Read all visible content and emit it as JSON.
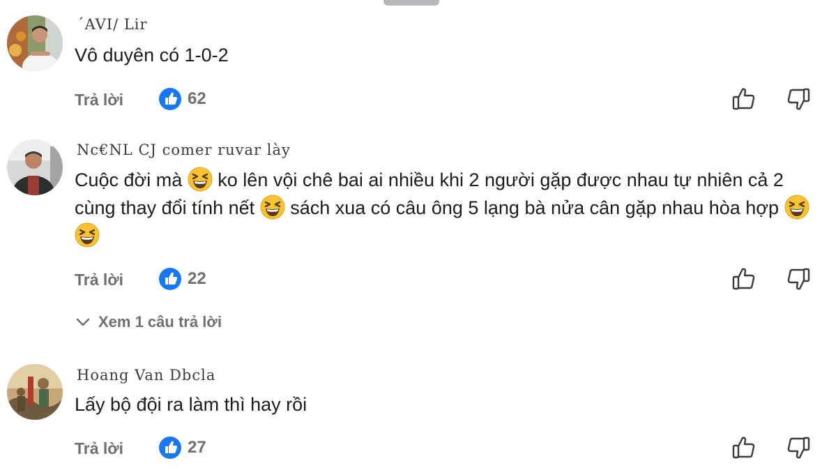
{
  "comments": [
    {
      "author": "ˊAVI/ Lir",
      "text": "Vô duyên có 1-0-2",
      "reply_label": "Trả lời",
      "like_count": "62"
    },
    {
      "author": "Nc€NL CJ comer ruvar lày",
      "text_parts": [
        "Cuộc đời mà",
        " ko lên vội chê bai ai nhiều khi 2 người gặp được nhau tự nhiên cả 2 cùng thay đổi tính nết",
        " sách xua có câu ông 5 lạng bà nửa cân gặp nhau hòa hợp"
      ],
      "reply_label": "Trả lời",
      "like_count": "22",
      "view_replies_label": "Xem 1 câu trả lời"
    },
    {
      "author": "Hoang Van Dbcla",
      "text": "Lấy bộ đội ra làm thì hay rồi",
      "reply_label": "Trả lời",
      "like_count": "27"
    }
  ],
  "icons": {
    "reaction": "like-reaction-icon",
    "like": "thumbs-up-outline-icon",
    "dislike": "thumbs-down-outline-icon",
    "expand": "chevron-down-icon",
    "emoji": "grinning-squinting-face-icon"
  },
  "colors": {
    "reaction_blue": "#1877f2",
    "meta_text": "#6e6e73",
    "body_text": "#1c1c1e"
  }
}
